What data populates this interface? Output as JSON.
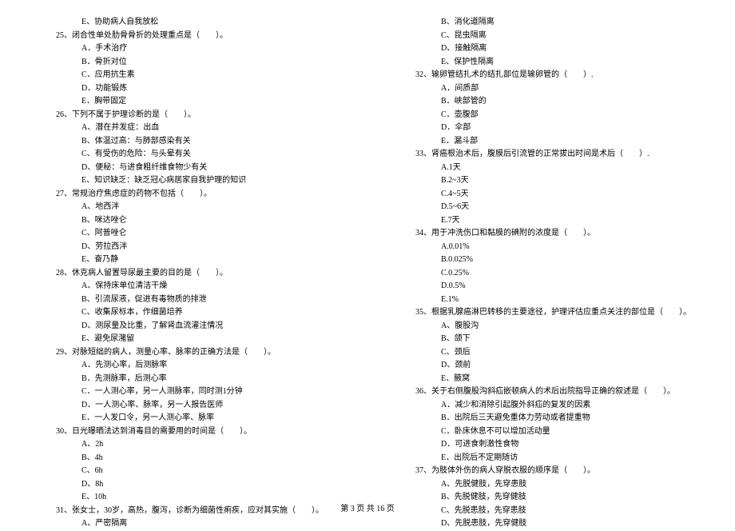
{
  "footer": "第 3 页 共 16 页",
  "left": [
    {
      "cls": "indent2",
      "text": "E、协助病人自我放松"
    },
    {
      "cls": "q-line",
      "text": "25、闭合性单处肋骨骨折的处理重点是（　　）。"
    },
    {
      "cls": "indent2",
      "text": "A．手术治疗"
    },
    {
      "cls": "indent2",
      "text": "B．骨折对位"
    },
    {
      "cls": "indent2",
      "text": "C．应用抗生素"
    },
    {
      "cls": "indent2",
      "text": "D．功能锻炼"
    },
    {
      "cls": "indent2",
      "text": "E．胸带固定"
    },
    {
      "cls": "q-line",
      "text": "26、下列不属于护理诊断的是（　　）。"
    },
    {
      "cls": "indent2",
      "text": "A、潜在并发症：出血"
    },
    {
      "cls": "indent2",
      "text": "B、体温过高：与肺部感染有关"
    },
    {
      "cls": "indent2",
      "text": "C、有受伤的危险：与头晕有关"
    },
    {
      "cls": "indent2",
      "text": "D、便秘：与进食粗纤维食物少有关"
    },
    {
      "cls": "indent2",
      "text": "E、知识缺乏：缺乏冠心病居家自我护理的知识"
    },
    {
      "cls": "q-line",
      "text": "27、常规治疗焦虑症的药物不包括（　　）。"
    },
    {
      "cls": "indent2",
      "text": "A、地西泮"
    },
    {
      "cls": "indent2",
      "text": "B、咪达唑仑"
    },
    {
      "cls": "indent2",
      "text": "C、阿普唑仑"
    },
    {
      "cls": "indent2",
      "text": "D、劳拉西泮"
    },
    {
      "cls": "indent2",
      "text": "E、奋乃静"
    },
    {
      "cls": "q-line",
      "text": "28、休克病人留置导尿最主要的目的是（　　）。"
    },
    {
      "cls": "indent2",
      "text": "A、保持床单位清洁干燥"
    },
    {
      "cls": "indent2",
      "text": "B、引流尿液，促进有毒物质的排泄"
    },
    {
      "cls": "indent2",
      "text": "C、收集尿标本，作细菌培养"
    },
    {
      "cls": "indent2",
      "text": "D、测尿量及比重，了解肾血流灌注情况"
    },
    {
      "cls": "indent2",
      "text": "E、避免尿潴留"
    },
    {
      "cls": "q-line",
      "text": "29、对脉短绌的病人，测量心率、脉率的正确方法是（　　）。"
    },
    {
      "cls": "indent2",
      "text": "A．先测心率，后测脉率"
    },
    {
      "cls": "indent2",
      "text": "B．先测脉率，后测心率"
    },
    {
      "cls": "indent2",
      "text": "C．一人测心率，另一人测脉率，同时测1分钟"
    },
    {
      "cls": "indent2",
      "text": "D．一人测心率、脉率，另一人报告医师"
    },
    {
      "cls": "indent2",
      "text": "E．一人发口令，另一人测心率、脉率"
    },
    {
      "cls": "q-line",
      "text": "30、日光曝晒法达到消毒目的需要用的时间是（　　）。"
    },
    {
      "cls": "indent2",
      "text": "A、2h"
    },
    {
      "cls": "indent2",
      "text": "B、4h"
    },
    {
      "cls": "indent2",
      "text": "C、6h"
    },
    {
      "cls": "indent2",
      "text": "D、8h"
    },
    {
      "cls": "indent2",
      "text": "E、10h"
    },
    {
      "cls": "q-line",
      "text": "31、张女士，30岁，高热，腹泻，诊断为细菌性痢疾，应对其实施（　　）。"
    },
    {
      "cls": "indent2",
      "text": "A、严密隔离"
    }
  ],
  "right": [
    {
      "cls": "indent2",
      "text": "B、消化道隔离"
    },
    {
      "cls": "indent2",
      "text": "C、昆虫隔离"
    },
    {
      "cls": "indent2",
      "text": "D、接触隔离"
    },
    {
      "cls": "indent2",
      "text": "E、保护性隔离"
    },
    {
      "cls": "q-line",
      "text": "32、输卵管结扎术的结扎部位是输卵管的（　　）."
    },
    {
      "cls": "indent2",
      "text": "A．间质部"
    },
    {
      "cls": "indent2",
      "text": "B．峡部管的"
    },
    {
      "cls": "indent2",
      "text": "C．壶腹部"
    },
    {
      "cls": "indent2",
      "text": "D．伞部"
    },
    {
      "cls": "indent2",
      "text": "E．漏斗部"
    },
    {
      "cls": "q-line",
      "text": "33、肾癌根治术后，腹膜后引流管的正常拔出时间是术后（　　）."
    },
    {
      "cls": "indent2",
      "text": "A.1天"
    },
    {
      "cls": "indent2",
      "text": "B.2~3天"
    },
    {
      "cls": "indent2",
      "text": "C.4~5天"
    },
    {
      "cls": "indent2",
      "text": "D.5~6天"
    },
    {
      "cls": "indent2",
      "text": "E.7天"
    },
    {
      "cls": "q-line",
      "text": "34、用于冲洗伤口和黏膜的碘附的浓度是（　　）。"
    },
    {
      "cls": "indent2",
      "text": "A.0.01%"
    },
    {
      "cls": "indent2",
      "text": "B.0.025%"
    },
    {
      "cls": "indent2",
      "text": "C.0.25%"
    },
    {
      "cls": "indent2",
      "text": "D.0.5%"
    },
    {
      "cls": "indent2",
      "text": "E.1%"
    },
    {
      "cls": "q-line",
      "text": "35、根据乳腺癌淋巴转移的主要途径，护理评估应重点关注的部位是（　　）。"
    },
    {
      "cls": "indent2",
      "text": "A、腹股沟"
    },
    {
      "cls": "indent2",
      "text": "B、颌下"
    },
    {
      "cls": "indent2",
      "text": "C、颈后"
    },
    {
      "cls": "indent2",
      "text": "D、颈前"
    },
    {
      "cls": "indent2",
      "text": "E、腋窝"
    },
    {
      "cls": "q-line",
      "text": "36、关于右侧腹股沟斜疝嵌顿病人的术后出院指导正确的叙述是（　　）。"
    },
    {
      "cls": "indent2",
      "text": "A．减少和消除引起腹外斜疝的复发的因素"
    },
    {
      "cls": "indent2",
      "text": "B．出院后三天避免重体力劳动或者提重物"
    },
    {
      "cls": "indent2",
      "text": "C．卧床休息不可以增加活动量"
    },
    {
      "cls": "indent2",
      "text": "D．可进食刺激性食物"
    },
    {
      "cls": "indent2",
      "text": "E．出院后不定期随访"
    },
    {
      "cls": "q-line",
      "text": "37、为肢体外伤的病人穿脱衣服的顺序是（　　）。"
    },
    {
      "cls": "indent2",
      "text": "A、先脱健肢，先穿患肢"
    },
    {
      "cls": "indent2",
      "text": "B、先脱健肢，先穿健肢"
    },
    {
      "cls": "indent2",
      "text": "C、先脱患肢，先穿患肢"
    },
    {
      "cls": "indent2",
      "text": "D、先脱患肢，先穿健肢"
    }
  ]
}
